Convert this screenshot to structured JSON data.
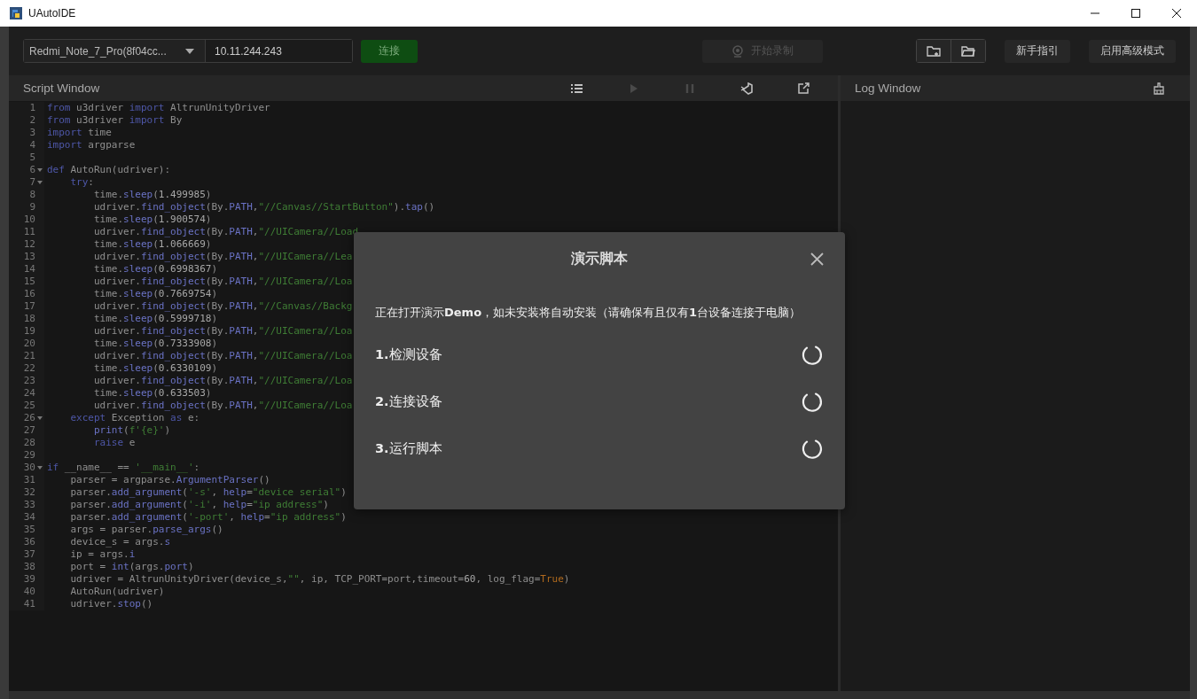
{
  "window": {
    "title": "UAutoIDE"
  },
  "toolbar": {
    "device_select": {
      "value": "Redmi_Note_7_Pro(8f04cc..."
    },
    "ip_field": {
      "value": "10.11.244.243"
    },
    "connect_button": {
      "label": "连接"
    },
    "record_button": {
      "label": "开始录制",
      "disabled": true
    },
    "guide_button": {
      "label": "新手指引"
    },
    "advanced_button": {
      "label": "启用高级模式"
    }
  },
  "script_window": {
    "title": "Script Window",
    "tools": [
      {
        "kind": "list",
        "disabled": false
      },
      {
        "kind": "play",
        "disabled": true
      },
      {
        "kind": "pause",
        "disabled": true
      },
      {
        "kind": "editor",
        "disabled": false
      },
      {
        "kind": "export",
        "disabled": false
      }
    ],
    "lines": [
      {
        "n": "1",
        "fold": false,
        "tokens": [
          {
            "kind": "kw",
            "text": "from"
          },
          {
            "kind": "tx",
            "text": " u3driver "
          },
          {
            "kind": "kw",
            "text": "import"
          },
          {
            "kind": "tx",
            "text": " AltrunUnityDriver"
          }
        ]
      },
      {
        "n": "2",
        "fold": false,
        "tokens": [
          {
            "kind": "kw",
            "text": "from"
          },
          {
            "kind": "tx",
            "text": " u3driver "
          },
          {
            "kind": "kw",
            "text": "import"
          },
          {
            "kind": "tx",
            "text": " By"
          }
        ]
      },
      {
        "n": "3",
        "fold": false,
        "tokens": [
          {
            "kind": "kw",
            "text": "import"
          },
          {
            "kind": "tx",
            "text": " time"
          }
        ]
      },
      {
        "n": "4",
        "fold": false,
        "tokens": [
          {
            "kind": "kw",
            "text": "import"
          },
          {
            "kind": "tx",
            "text": " argparse"
          }
        ]
      },
      {
        "n": "5",
        "fold": false
      },
      {
        "n": "6",
        "fold": true,
        "tokens": [
          {
            "kind": "kw",
            "text": "def"
          },
          {
            "kind": "tx",
            "text": " AutoRun(udriver):"
          }
        ]
      },
      {
        "n": "7",
        "fold": true,
        "tokens": [
          {
            "kind": "kw",
            "text": "    try"
          },
          {
            "kind": "tx",
            "text": ":"
          }
        ]
      },
      {
        "n": "8",
        "fold": false,
        "tokens": [
          {
            "kind": "tx",
            "text": "        time."
          },
          {
            "kind": "fn",
            "text": "sleep"
          },
          {
            "kind": "tx",
            "text": "("
          },
          {
            "kind": "num",
            "text": "1.499985"
          },
          {
            "kind": "tx",
            "text": ")"
          }
        ]
      },
      {
        "n": "9",
        "fold": false,
        "tokens": [
          {
            "kind": "tx",
            "text": "        udriver."
          },
          {
            "kind": "fn",
            "text": "find_object"
          },
          {
            "kind": "tx",
            "text": "(By."
          },
          {
            "kind": "fn",
            "text": "PATH"
          },
          {
            "kind": "tx",
            "text": ","
          },
          {
            "kind": "str",
            "text": "\"//Canvas//StartButton\""
          },
          {
            "kind": "tx",
            "text": ")."
          },
          {
            "kind": "fn",
            "text": "tap"
          },
          {
            "kind": "tx",
            "text": "()"
          }
        ]
      },
      {
        "n": "10",
        "fold": false,
        "tokens": [
          {
            "kind": "tx",
            "text": "        time."
          },
          {
            "kind": "fn",
            "text": "sleep"
          },
          {
            "kind": "tx",
            "text": "("
          },
          {
            "kind": "num",
            "text": "1.900574"
          },
          {
            "kind": "tx",
            "text": ")"
          }
        ]
      },
      {
        "n": "11",
        "fold": false,
        "tokens": [
          {
            "kind": "tx",
            "text": "        udriver."
          },
          {
            "kind": "fn",
            "text": "find_object"
          },
          {
            "kind": "tx",
            "text": "(By."
          },
          {
            "kind": "fn",
            "text": "PATH"
          },
          {
            "kind": "tx",
            "text": ","
          },
          {
            "kind": "str",
            "text": "\"//UICamera//Load"
          }
        ]
      },
      {
        "n": "12",
        "fold": false,
        "tokens": [
          {
            "kind": "tx",
            "text": "        time."
          },
          {
            "kind": "fn",
            "text": "sleep"
          },
          {
            "kind": "tx",
            "text": "("
          },
          {
            "kind": "num",
            "text": "1.066669"
          },
          {
            "kind": "tx",
            "text": ")"
          }
        ]
      },
      {
        "n": "13",
        "fold": false,
        "tokens": [
          {
            "kind": "tx",
            "text": "        udriver."
          },
          {
            "kind": "fn",
            "text": "find_object"
          },
          {
            "kind": "tx",
            "text": "(By."
          },
          {
            "kind": "fn",
            "text": "PATH"
          },
          {
            "kind": "tx",
            "text": ","
          },
          {
            "kind": "str",
            "text": "\"//UICamera//Lea"
          }
        ]
      },
      {
        "n": "14",
        "fold": false,
        "tokens": [
          {
            "kind": "tx",
            "text": "        time."
          },
          {
            "kind": "fn",
            "text": "sleep"
          },
          {
            "kind": "tx",
            "text": "("
          },
          {
            "kind": "num",
            "text": "0.6998367"
          },
          {
            "kind": "tx",
            "text": ")"
          }
        ]
      },
      {
        "n": "15",
        "fold": false,
        "tokens": [
          {
            "kind": "tx",
            "text": "        udriver."
          },
          {
            "kind": "fn",
            "text": "find_object"
          },
          {
            "kind": "tx",
            "text": "(By."
          },
          {
            "kind": "fn",
            "text": "PATH"
          },
          {
            "kind": "tx",
            "text": ","
          },
          {
            "kind": "str",
            "text": "\"//UICamera//Loa"
          }
        ]
      },
      {
        "n": "16",
        "fold": false,
        "tokens": [
          {
            "kind": "tx",
            "text": "        time."
          },
          {
            "kind": "fn",
            "text": "sleep"
          },
          {
            "kind": "tx",
            "text": "("
          },
          {
            "kind": "num",
            "text": "0.7669754"
          },
          {
            "kind": "tx",
            "text": ")"
          }
        ]
      },
      {
        "n": "17",
        "fold": false,
        "tokens": [
          {
            "kind": "tx",
            "text": "        udriver."
          },
          {
            "kind": "fn",
            "text": "find_object"
          },
          {
            "kind": "tx",
            "text": "(By."
          },
          {
            "kind": "fn",
            "text": "PATH"
          },
          {
            "kind": "tx",
            "text": ","
          },
          {
            "kind": "str",
            "text": "\"//Canvas//Backg"
          }
        ]
      },
      {
        "n": "18",
        "fold": false,
        "tokens": [
          {
            "kind": "tx",
            "text": "        time."
          },
          {
            "kind": "fn",
            "text": "sleep"
          },
          {
            "kind": "tx",
            "text": "("
          },
          {
            "kind": "num",
            "text": "0.5999718"
          },
          {
            "kind": "tx",
            "text": ")"
          }
        ]
      },
      {
        "n": "19",
        "fold": false,
        "tokens": [
          {
            "kind": "tx",
            "text": "        udriver."
          },
          {
            "kind": "fn",
            "text": "find_object"
          },
          {
            "kind": "tx",
            "text": "(By."
          },
          {
            "kind": "fn",
            "text": "PATH"
          },
          {
            "kind": "tx",
            "text": ","
          },
          {
            "kind": "str",
            "text": "\"//UICamera//Loa"
          }
        ]
      },
      {
        "n": "20",
        "fold": false,
        "tokens": [
          {
            "kind": "tx",
            "text": "        time."
          },
          {
            "kind": "fn",
            "text": "sleep"
          },
          {
            "kind": "tx",
            "text": "("
          },
          {
            "kind": "num",
            "text": "0.7333908"
          },
          {
            "kind": "tx",
            "text": ")"
          }
        ]
      },
      {
        "n": "21",
        "fold": false,
        "tokens": [
          {
            "kind": "tx",
            "text": "        udriver."
          },
          {
            "kind": "fn",
            "text": "find_object"
          },
          {
            "kind": "tx",
            "text": "(By."
          },
          {
            "kind": "fn",
            "text": "PATH"
          },
          {
            "kind": "tx",
            "text": ","
          },
          {
            "kind": "str",
            "text": "\"//UICamera//Loa"
          }
        ]
      },
      {
        "n": "22",
        "fold": false,
        "tokens": [
          {
            "kind": "tx",
            "text": "        time."
          },
          {
            "kind": "fn",
            "text": "sleep"
          },
          {
            "kind": "tx",
            "text": "("
          },
          {
            "kind": "num",
            "text": "0.6330109"
          },
          {
            "kind": "tx",
            "text": ")"
          }
        ]
      },
      {
        "n": "23",
        "fold": false,
        "tokens": [
          {
            "kind": "tx",
            "text": "        udriver."
          },
          {
            "kind": "fn",
            "text": "find_object"
          },
          {
            "kind": "tx",
            "text": "(By."
          },
          {
            "kind": "fn",
            "text": "PATH"
          },
          {
            "kind": "tx",
            "text": ","
          },
          {
            "kind": "str",
            "text": "\"//UICamera//Loa"
          }
        ]
      },
      {
        "n": "24",
        "fold": false,
        "tokens": [
          {
            "kind": "tx",
            "text": "        time."
          },
          {
            "kind": "fn",
            "text": "sleep"
          },
          {
            "kind": "tx",
            "text": "("
          },
          {
            "kind": "num",
            "text": "0.633503"
          },
          {
            "kind": "tx",
            "text": ")"
          }
        ]
      },
      {
        "n": "25",
        "fold": false,
        "tokens": [
          {
            "kind": "tx",
            "text": "        udriver."
          },
          {
            "kind": "fn",
            "text": "find_object"
          },
          {
            "kind": "tx",
            "text": "(By."
          },
          {
            "kind": "fn",
            "text": "PATH"
          },
          {
            "kind": "tx",
            "text": ","
          },
          {
            "kind": "str",
            "text": "\"//UICamera//Loa"
          }
        ]
      },
      {
        "n": "26",
        "fold": true,
        "tokens": [
          {
            "kind": "kw",
            "text": "    except"
          },
          {
            "kind": "tx",
            "text": " Exception "
          },
          {
            "kind": "kw",
            "text": "as"
          },
          {
            "kind": "tx",
            "text": " e:"
          }
        ]
      },
      {
        "n": "27",
        "fold": false,
        "tokens": [
          {
            "kind": "fn",
            "text": "        print"
          },
          {
            "kind": "tx",
            "text": "("
          },
          {
            "kind": "str",
            "text": "f'{e}'"
          },
          {
            "kind": "tx",
            "text": ")"
          }
        ]
      },
      {
        "n": "28",
        "fold": false,
        "tokens": [
          {
            "kind": "kw",
            "text": "        raise"
          },
          {
            "kind": "tx",
            "text": " e"
          }
        ]
      },
      {
        "n": "29",
        "fold": false
      },
      {
        "n": "30",
        "fold": true,
        "tokens": [
          {
            "kind": "kw",
            "text": "if"
          },
          {
            "kind": "tx",
            "text": " __name__ == "
          },
          {
            "kind": "str",
            "text": "'__main__'"
          },
          {
            "kind": "tx",
            "text": ":"
          }
        ]
      },
      {
        "n": "31",
        "fold": false,
        "tokens": [
          {
            "kind": "tx",
            "text": "    parser = argparse."
          },
          {
            "kind": "fn",
            "text": "ArgumentParser"
          },
          {
            "kind": "tx",
            "text": "()"
          }
        ]
      },
      {
        "n": "32",
        "fold": false,
        "tokens": [
          {
            "kind": "tx",
            "text": "    parser."
          },
          {
            "kind": "fn",
            "text": "add_argument"
          },
          {
            "kind": "tx",
            "text": "("
          },
          {
            "kind": "str",
            "text": "'-s'"
          },
          {
            "kind": "tx",
            "text": ", "
          },
          {
            "kind": "fn",
            "text": "help"
          },
          {
            "kind": "tx",
            "text": "="
          },
          {
            "kind": "str",
            "text": "\"device serial\""
          },
          {
            "kind": "tx",
            "text": ")"
          }
        ]
      },
      {
        "n": "33",
        "fold": false,
        "tokens": [
          {
            "kind": "tx",
            "text": "    parser."
          },
          {
            "kind": "fn",
            "text": "add_argument"
          },
          {
            "kind": "tx",
            "text": "("
          },
          {
            "kind": "str",
            "text": "'-i'"
          },
          {
            "kind": "tx",
            "text": ", "
          },
          {
            "kind": "fn",
            "text": "help"
          },
          {
            "kind": "tx",
            "text": "="
          },
          {
            "kind": "str",
            "text": "\"ip address\""
          },
          {
            "kind": "tx",
            "text": ")"
          }
        ]
      },
      {
        "n": "34",
        "fold": false,
        "tokens": [
          {
            "kind": "tx",
            "text": "    parser."
          },
          {
            "kind": "fn",
            "text": "add_argument"
          },
          {
            "kind": "tx",
            "text": "("
          },
          {
            "kind": "str",
            "text": "'-port'"
          },
          {
            "kind": "tx",
            "text": ", "
          },
          {
            "kind": "fn",
            "text": "help"
          },
          {
            "kind": "tx",
            "text": "="
          },
          {
            "kind": "str",
            "text": "\"ip address\""
          },
          {
            "kind": "tx",
            "text": ")"
          }
        ]
      },
      {
        "n": "35",
        "fold": false,
        "tokens": [
          {
            "kind": "tx",
            "text": "    args = parser."
          },
          {
            "kind": "fn",
            "text": "parse_args"
          },
          {
            "kind": "tx",
            "text": "()"
          }
        ]
      },
      {
        "n": "36",
        "fold": false,
        "tokens": [
          {
            "kind": "tx",
            "text": "    device_s = args."
          },
          {
            "kind": "fn",
            "text": "s"
          }
        ]
      },
      {
        "n": "37",
        "fold": false,
        "tokens": [
          {
            "kind": "tx",
            "text": "    ip = args."
          },
          {
            "kind": "fn",
            "text": "i"
          }
        ]
      },
      {
        "n": "38",
        "fold": false,
        "tokens": [
          {
            "kind": "tx",
            "text": "    port = "
          },
          {
            "kind": "fn",
            "text": "int"
          },
          {
            "kind": "tx",
            "text": "(args."
          },
          {
            "kind": "fn",
            "text": "port"
          },
          {
            "kind": "tx",
            "text": ")"
          }
        ]
      },
      {
        "n": "39",
        "fold": false,
        "tokens": [
          {
            "kind": "tx",
            "text": "    udriver = AltrunUnityDriver(device_s,"
          },
          {
            "kind": "str",
            "text": "\"\""
          },
          {
            "kind": "tx",
            "text": ", ip, TCP_PORT=port,timeout="
          },
          {
            "kind": "num",
            "text": "60"
          },
          {
            "kind": "tx",
            "text": ", log_flag="
          },
          {
            "kind": "const",
            "text": "True"
          },
          {
            "kind": "tx",
            "text": ")"
          }
        ]
      },
      {
        "n": "40",
        "fold": false,
        "tokens": [
          {
            "kind": "tx",
            "text": "    AutoRun(udriver)"
          }
        ]
      },
      {
        "n": "41",
        "fold": false,
        "tokens": [
          {
            "kind": "tx",
            "text": "    udriver."
          },
          {
            "kind": "fn",
            "text": "stop"
          },
          {
            "kind": "tx",
            "text": "()"
          }
        ]
      }
    ]
  },
  "log_window": {
    "title": "Log Window"
  },
  "dialog": {
    "title": "演示脚本",
    "message": "正在打开演示**Demo**，如未安装将自动安装（请确保有且仅有**1**台设备连接于电脑）",
    "steps": [
      {
        "label": "**1.**检测设备"
      },
      {
        "label": "**2.**连接设备"
      },
      {
        "label": "**3.**运行脚本"
      }
    ]
  }
}
